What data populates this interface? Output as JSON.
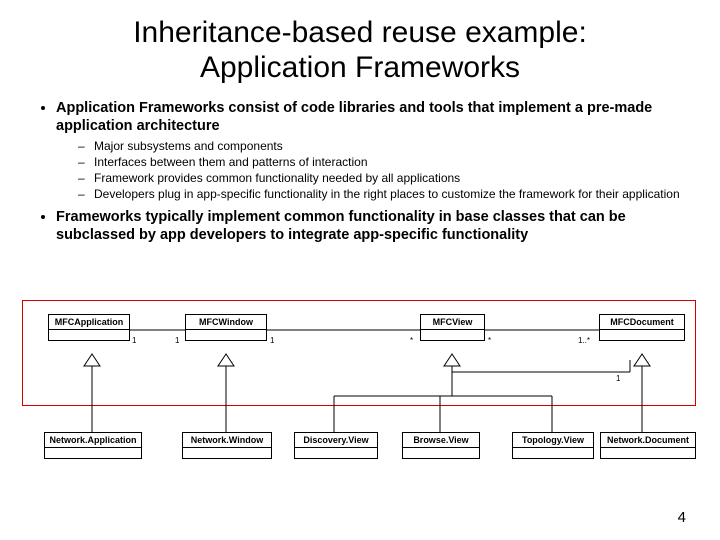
{
  "title_line1": "Inheritance-based reuse example:",
  "title_line2": "Application Frameworks",
  "bullets": {
    "b1": "Application Frameworks consist of code libraries and tools that implement a pre-made application architecture",
    "b1_sub": {
      "s1": "Major subsystems and components",
      "s2": "Interfaces between them and patterns of interaction",
      "s3": "Framework provides common functionality needed by all applications",
      "s4": "Developers plug in app-specific functionality in the right places to customize the framework for their application"
    },
    "b2": "Frameworks typically implement common functionality in base classes that can be subclassed by app developers to integrate app-specific functionality"
  },
  "diagram": {
    "top_row": {
      "c1": "MFCApplication",
      "c2": "MFCWindow",
      "c3": "MFCView",
      "c4": "MFCDocument"
    },
    "bottom_row": {
      "c1": "Network.Application",
      "c2": "Network.Window",
      "c3": "Discovery.View",
      "c4": "Browse.View",
      "c5": "Topology.View",
      "c6": "Network.Document"
    },
    "mult": {
      "m_app_r": "1",
      "m_win_l": "1",
      "m_win_r": "1",
      "m_view_l": "*",
      "m_view_r": "*",
      "m_doc_l": "1..*",
      "m_doc_r2": "1"
    }
  },
  "page_number": "4"
}
